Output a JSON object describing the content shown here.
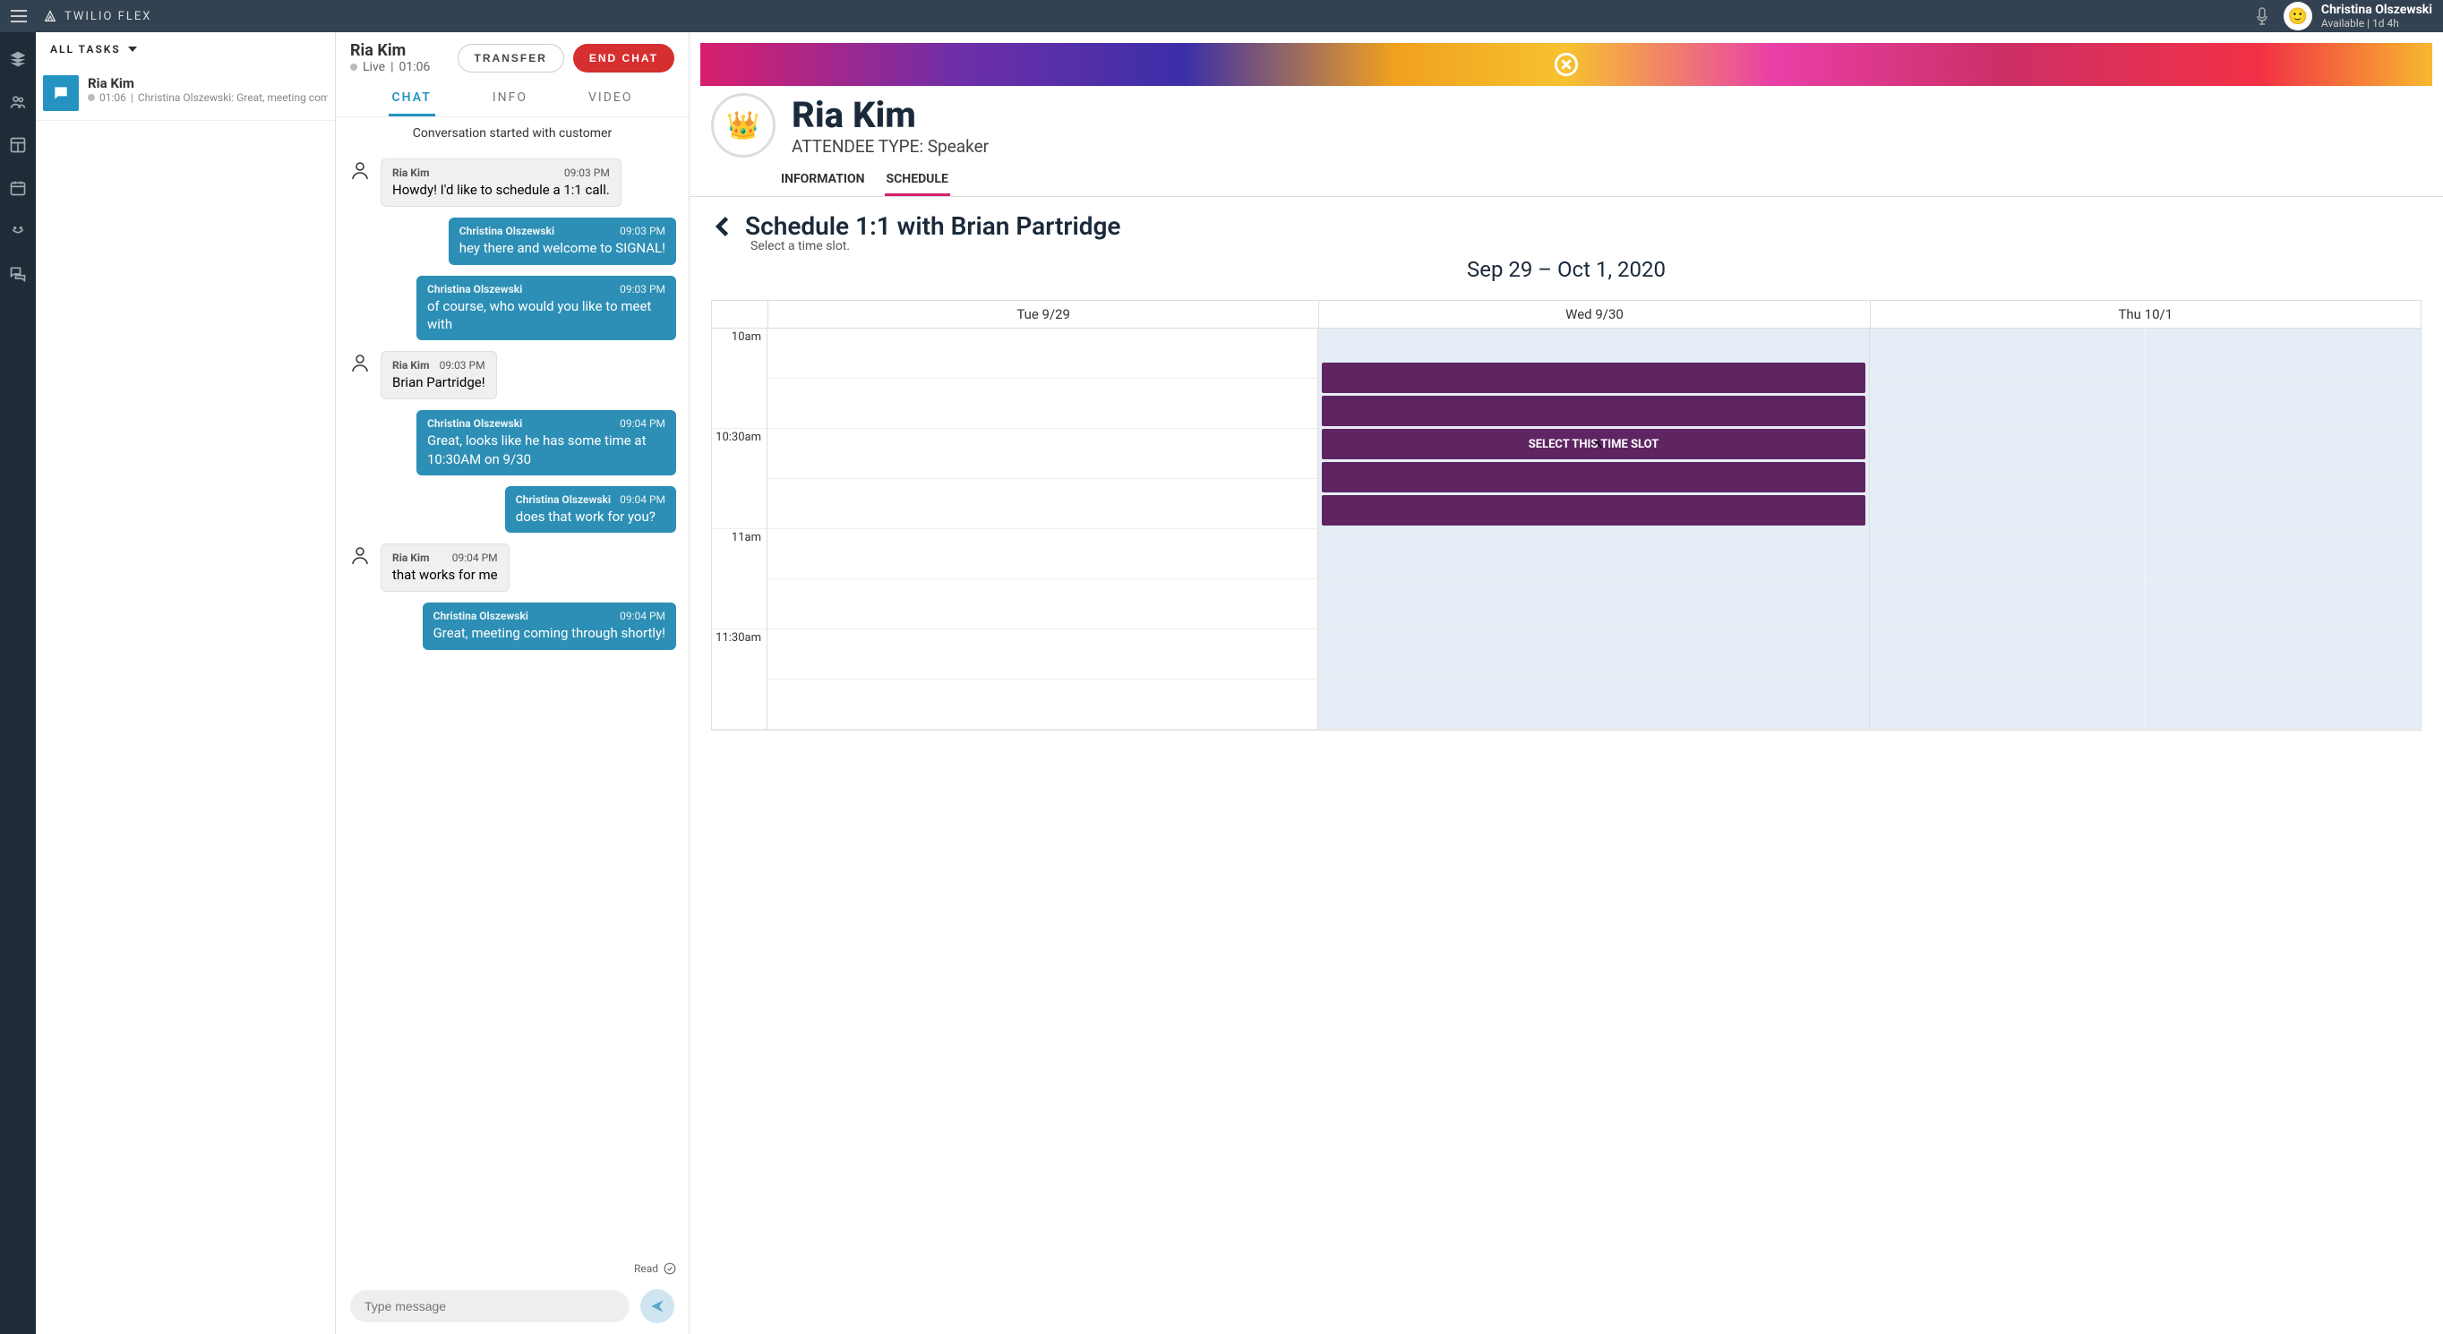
{
  "brand": "TWILIO FLEX",
  "user": {
    "name": "Christina Olszewski",
    "status": "Available | 1d 4h"
  },
  "tasklist": {
    "header": "ALL TASKS",
    "items": [
      {
        "title": "Ria Kim",
        "duration": "01:06",
        "preview": "Christina Olszewski: Great, meeting coming"
      }
    ]
  },
  "chat": {
    "name": "Ria Kim",
    "status_label": "Live",
    "duration": "01:06",
    "actions": {
      "transfer": "TRANSFER",
      "endchat": "END CHAT"
    },
    "tabs": {
      "chat": "CHAT",
      "info": "INFO",
      "video": "VIDEO"
    },
    "conv_started": "Conversation started with customer",
    "messages": [
      {
        "dir": "in",
        "sender": "Ria Kim",
        "time": "09:03 PM",
        "text": "Howdy! I'd like to schedule a 1:1 call."
      },
      {
        "dir": "out",
        "sender": "Christina Olszewski",
        "time": "09:03 PM",
        "text": "hey there and welcome to SIGNAL!"
      },
      {
        "dir": "out",
        "sender": "Christina Olszewski",
        "time": "09:03 PM",
        "text": "of course, who would you like to meet with"
      },
      {
        "dir": "in",
        "sender": "Ria Kim",
        "time": "09:03 PM",
        "text": "Brian Partridge!"
      },
      {
        "dir": "out",
        "sender": "Christina Olszewski",
        "time": "09:04 PM",
        "text": "Great, looks like he has some time at 10:30AM on 9/30"
      },
      {
        "dir": "out",
        "sender": "Christina Olszewski",
        "time": "09:04 PM",
        "text": "does that work for you?"
      },
      {
        "dir": "in",
        "sender": "Ria Kim",
        "time": "09:04 PM",
        "text": "that works for me"
      },
      {
        "dir": "out",
        "sender": "Christina Olszewski",
        "time": "09:04 PM",
        "text": "Great, meeting coming through shortly!"
      }
    ],
    "read_label": "Read",
    "compose_placeholder": "Type message"
  },
  "profile": {
    "name": "Ria Kim",
    "type_label": "ATTENDEE TYPE: Speaker",
    "tabs": {
      "information": "INFORMATION",
      "schedule": "SCHEDULE"
    }
  },
  "schedule": {
    "title": "Schedule 1:1 with Brian Partridge",
    "subtitle": "Select a time slot.",
    "range": "Sep 29 – Oct 1, 2020",
    "days": [
      "Tue 9/29",
      "Wed 9/30",
      "Thu 10/1"
    ],
    "times": [
      "10am",
      "10:30am",
      "11am",
      "11:30am"
    ],
    "select_slot_label": "SELECT THIS TIME SLOT"
  }
}
